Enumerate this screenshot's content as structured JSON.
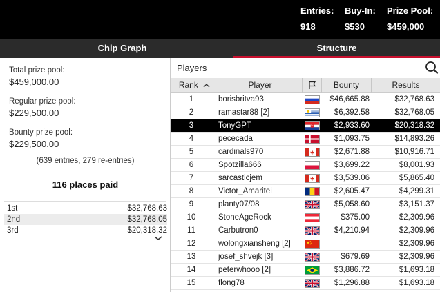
{
  "header": {
    "entries_label": "Entries:",
    "entries_value": "918",
    "buyin_label": "Buy-In:",
    "buyin_value": "$530",
    "prize_label": "Prize Pool:",
    "prize_value": "$459,000"
  },
  "tabs": [
    {
      "label": "Chip Graph",
      "active": false
    },
    {
      "label": "Structure",
      "active": true
    }
  ],
  "summary": {
    "total_label": "Total prize pool:",
    "total_value": "$459,000.00",
    "regular_label": "Regular prize pool:",
    "regular_value": "$229,500.00",
    "bounty_label": "Bounty prize pool:",
    "bounty_value": "$229,500.00",
    "entries_note": "(639 entries, 279 re-entries)",
    "places_paid": "116 places paid"
  },
  "places": [
    {
      "place": "1st",
      "amount": "$32,768.63"
    },
    {
      "place": "2nd",
      "amount": "$32,768.05"
    },
    {
      "place": "3rd",
      "amount": "$20,318.32"
    }
  ],
  "players_panel": {
    "title": "Players",
    "columns": {
      "rank": "Rank",
      "player": "Player",
      "bounty": "Bounty",
      "results": "Results"
    }
  },
  "players": [
    {
      "rank": "1",
      "name": "borisbritva93",
      "flag": "russia",
      "bounty": "$46,665.88",
      "result": "$32,768.63"
    },
    {
      "rank": "2",
      "name": "ramastar88 [2]",
      "flag": "uruguay",
      "bounty": "$6,392.58",
      "result": "$32,768.05"
    },
    {
      "rank": "3",
      "name": "TonyGPT",
      "flag": "croatia",
      "bounty": "$2,933.60",
      "result": "$20,318.32"
    },
    {
      "rank": "4",
      "name": "pececada",
      "flag": "denmark",
      "bounty": "$1,093.75",
      "result": "$14,893.26"
    },
    {
      "rank": "5",
      "name": "cardinals970",
      "flag": "canada",
      "bounty": "$2,671.88",
      "result": "$10,916.71"
    },
    {
      "rank": "6",
      "name": "Spotzilla666",
      "flag": "poland",
      "bounty": "$3,699.22",
      "result": "$8,001.93"
    },
    {
      "rank": "7",
      "name": "sarcasticjem",
      "flag": "canada",
      "bounty": "$3,539.06",
      "result": "$5,865.40"
    },
    {
      "rank": "8",
      "name": "Victor_Amaritei",
      "flag": "romania",
      "bounty": "$2,605.47",
      "result": "$4,299.31"
    },
    {
      "rank": "9",
      "name": "planty07/08",
      "flag": "uk",
      "bounty": "$5,058.60",
      "result": "$3,151.37"
    },
    {
      "rank": "10",
      "name": "StoneAgeRock",
      "flag": "austria",
      "bounty": "$375.00",
      "result": "$2,309.96"
    },
    {
      "rank": "11",
      "name": "Carbutron0",
      "flag": "uk",
      "bounty": "$4,210.94",
      "result": "$2,309.96"
    },
    {
      "rank": "12",
      "name": "wolongxiansheng [2]",
      "flag": "china",
      "bounty": "",
      "result": "$2,309.96"
    },
    {
      "rank": "13",
      "name": "josef_shvejk [3]",
      "flag": "uk",
      "bounty": "$679.69",
      "result": "$2,309.96"
    },
    {
      "rank": "14",
      "name": "peterwhooo [2]",
      "flag": "brazil",
      "bounty": "$3,886.72",
      "result": "$1,693.18"
    },
    {
      "rank": "15",
      "name": "flong78",
      "flag": "uk",
      "bounty": "$1,296.88",
      "result": "$1,693.18"
    }
  ],
  "selected_rank": "3",
  "colors": {
    "accent": "#c8102e",
    "header_bg": "#000000",
    "tab_bg": "#2b2b2b"
  }
}
